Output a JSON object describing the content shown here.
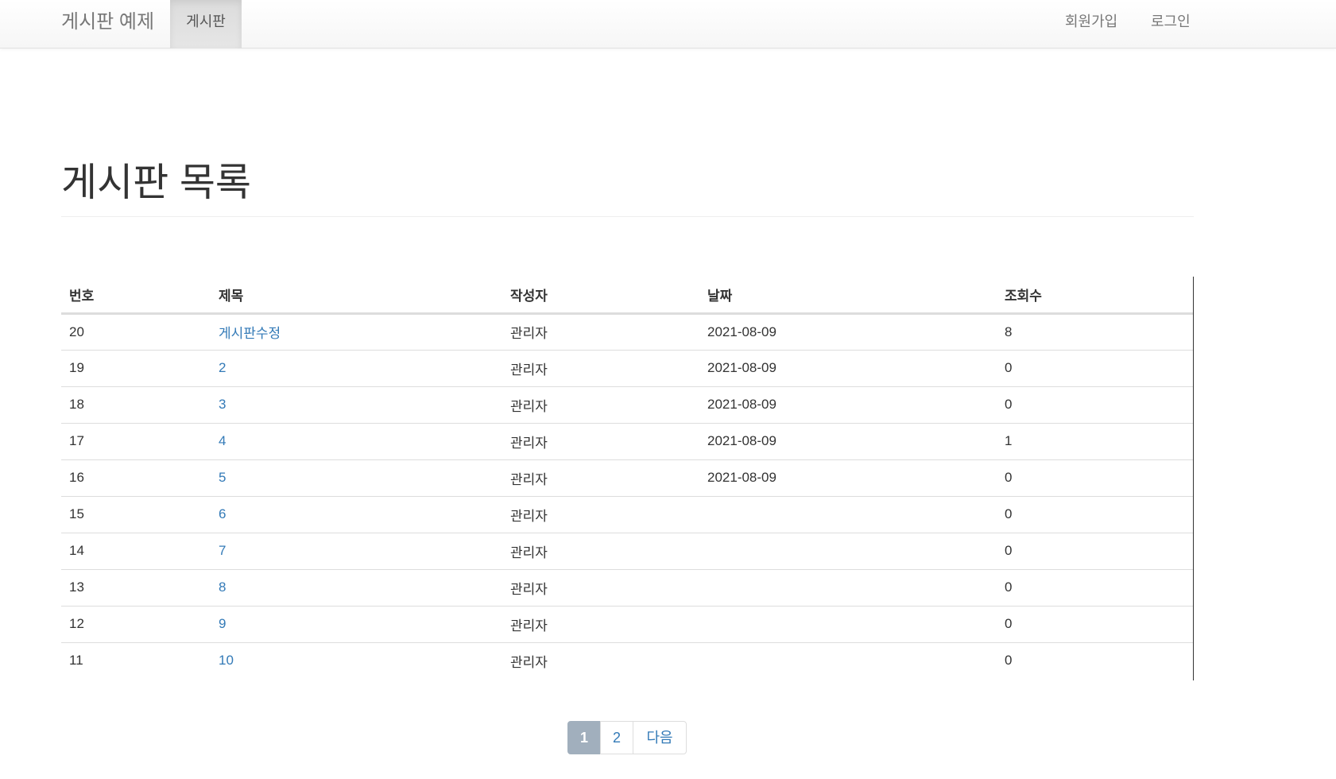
{
  "navbar": {
    "brand": "게시판 예제",
    "active_item": "게시판",
    "signup": "회원가입",
    "login": "로그인"
  },
  "page": {
    "title": "게시판 목록"
  },
  "table": {
    "headers": [
      "번호",
      "제목",
      "작성자",
      "날짜",
      "조회수"
    ],
    "rows": [
      {
        "no": "20",
        "title": "게시판수정",
        "author": "관리자",
        "date": "2021-08-09",
        "views": "8"
      },
      {
        "no": "19",
        "title": "2",
        "author": "관리자",
        "date": "2021-08-09",
        "views": "0"
      },
      {
        "no": "18",
        "title": "3",
        "author": "관리자",
        "date": "2021-08-09",
        "views": "0"
      },
      {
        "no": "17",
        "title": "4",
        "author": "관리자",
        "date": "2021-08-09",
        "views": "1"
      },
      {
        "no": "16",
        "title": "5",
        "author": "관리자",
        "date": "2021-08-09",
        "views": "0"
      },
      {
        "no": "15",
        "title": "6",
        "author": "관리자",
        "date": "",
        "views": "0"
      },
      {
        "no": "14",
        "title": "7",
        "author": "관리자",
        "date": "",
        "views": "0"
      },
      {
        "no": "13",
        "title": "8",
        "author": "관리자",
        "date": "",
        "views": "0"
      },
      {
        "no": "12",
        "title": "9",
        "author": "관리자",
        "date": "",
        "views": "0"
      },
      {
        "no": "11",
        "title": "10",
        "author": "관리자",
        "date": "",
        "views": "0"
      }
    ]
  },
  "pagination": {
    "current": "1",
    "page2": "2",
    "next": "다음"
  },
  "colors": {
    "link": "#337ab7",
    "active_page_bg": "#a1afbd"
  }
}
